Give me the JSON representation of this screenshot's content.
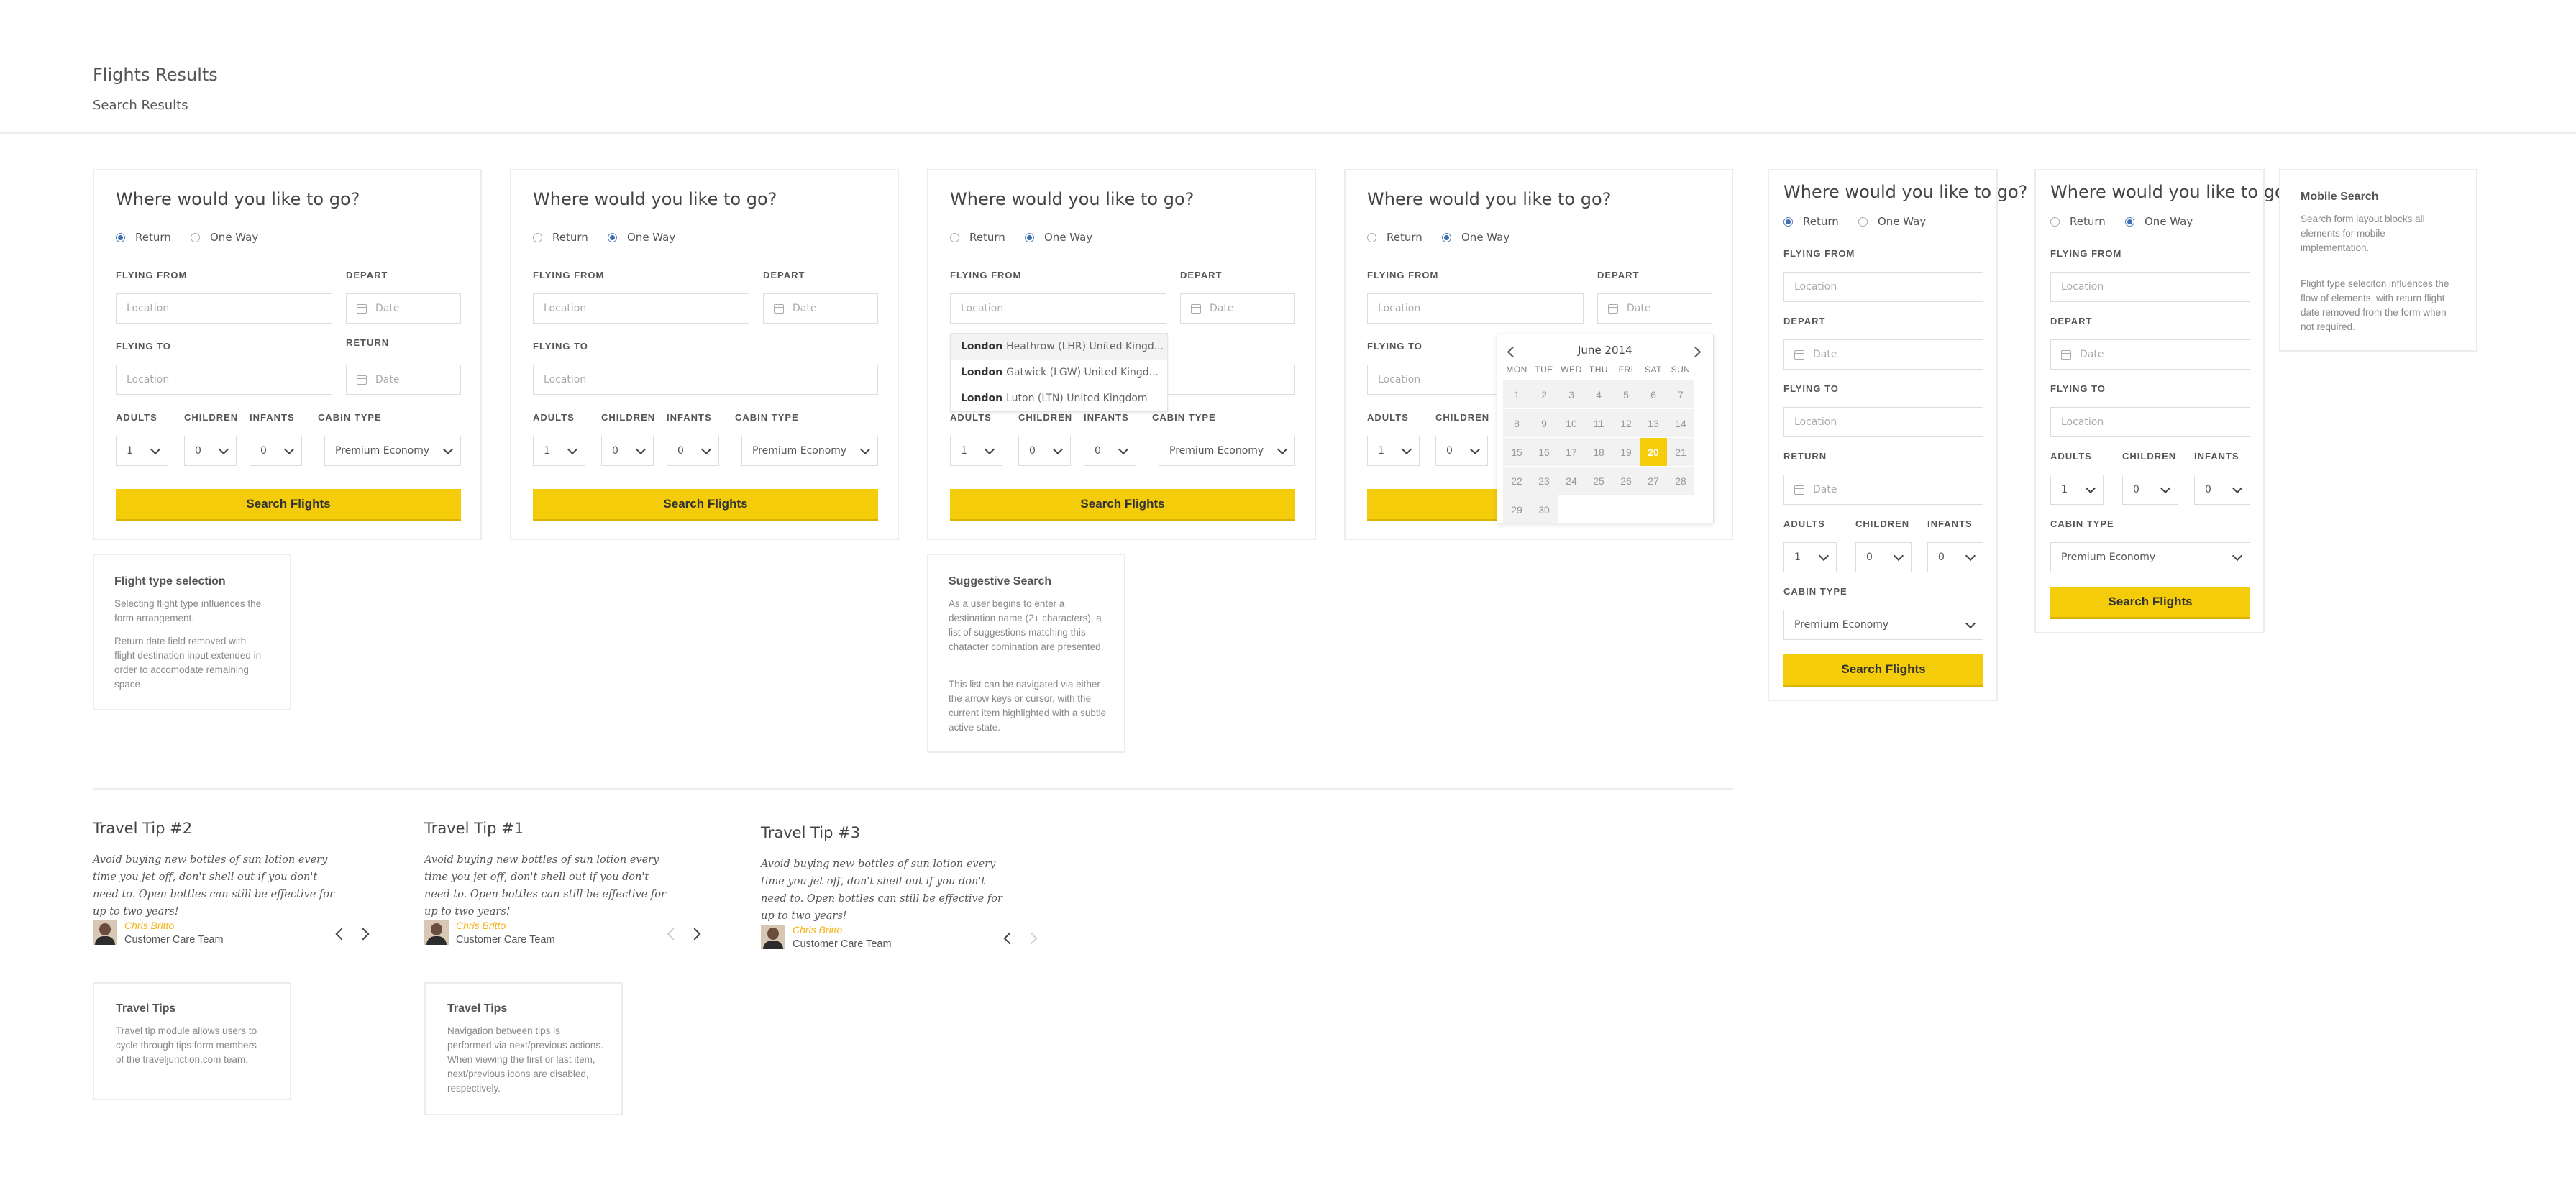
{
  "page": {
    "title": "Flights Results",
    "subtitle": "Search Results"
  },
  "form": {
    "heading": "Where would you like to go?",
    "return_label": "Return",
    "oneway_label": "One Way",
    "flying_from": "FLYING FROM",
    "flying_to": "FLYING TO",
    "depart": "DEPART",
    "return": "RETURN",
    "adults": "ADULTS",
    "children": "CHILDREN",
    "infants": "INFANTS",
    "cabin_type": "CABIN TYPE",
    "location_placeholder": "Location",
    "date_placeholder": "Date",
    "adults_value": "1",
    "children_value": "0",
    "infants_value": "0",
    "cabin_value": "Premium Economy",
    "search_button": "Search Flights"
  },
  "suggestions": [
    {
      "city": "London",
      "detail": "Heathrow (LHR) United Kingd..."
    },
    {
      "city": "London",
      "detail": "Gatwick (LGW) United Kingd..."
    },
    {
      "city": "London",
      "detail": "Luton (LTN) United Kingdom"
    }
  ],
  "calendar": {
    "month": "June 2014",
    "weekdays": [
      "MON",
      "TUE",
      "WED",
      "THU",
      "FRI",
      "SAT",
      "SUN"
    ],
    "days": [
      "1",
      "2",
      "3",
      "4",
      "5",
      "6",
      "7",
      "8",
      "9",
      "10",
      "11",
      "12",
      "13",
      "14",
      "15",
      "16",
      "17",
      "18",
      "19",
      "20",
      "21",
      "22",
      "23",
      "24",
      "25",
      "26",
      "27",
      "28",
      "29",
      "30"
    ],
    "selected": "20"
  },
  "notes": {
    "flight_type": {
      "title": "Flight type selection",
      "p1": "Selecting flight type influences the form arrangement.",
      "p2": "Return date field removed with flight destination input extended in order to accomodate remaining space."
    },
    "suggestive": {
      "title": "Suggestive Search",
      "p1": "As a user begins to enter a destination name (2+ characters), a list of suggestions matching this chatacter comination are presented.",
      "p2": "This list can be navigated via either the arrow keys or cursor, with the current item highlighted with a subtle active state."
    },
    "mobile": {
      "title": "Mobile Search",
      "p1": "Search form layout blocks all elements for mobile implementation.",
      "p2": "Flight type seleciton influences the flow of elements, with return flight date removed from the form when not required."
    },
    "travel_tips": {
      "title": "Travel Tips",
      "p1": "Travel tip module allows users to cycle through tips form members of the traveljunction.com team."
    },
    "travel_tips_nav": {
      "title": "Travel Tips",
      "p1": "Navigation between tips is performed via next/previous actions. When viewing the first or last item, next/previous icons are disabled, respectively."
    }
  },
  "tips": [
    {
      "title": "Travel Tip #2",
      "text": "Avoid buying new bottles of sun lotion every time you jet off, don't shell out if you don't need to. Open bottles can still be effective for up to two years!",
      "author": "Chris Britto",
      "team": "Customer Care Team"
    },
    {
      "title": "Travel Tip #1",
      "text": "Avoid buying new bottles of sun lotion every time you jet off, don't shell out if you don't need to. Open bottles can still be effective for up to two years!",
      "author": "Chris Britto",
      "team": "Customer Care Team"
    },
    {
      "title": "Travel Tip #3",
      "text": "Avoid buying new bottles of sun lotion every time you jet off, don't shell out if you don't need to. Open bottles can still be effective for up to two years!",
      "author": "Chris Britto",
      "team": "Customer Care Team"
    }
  ],
  "colors": {
    "accent": "#f5cc0a",
    "author": "#f3b315",
    "radio": "#3d6eb4"
  }
}
